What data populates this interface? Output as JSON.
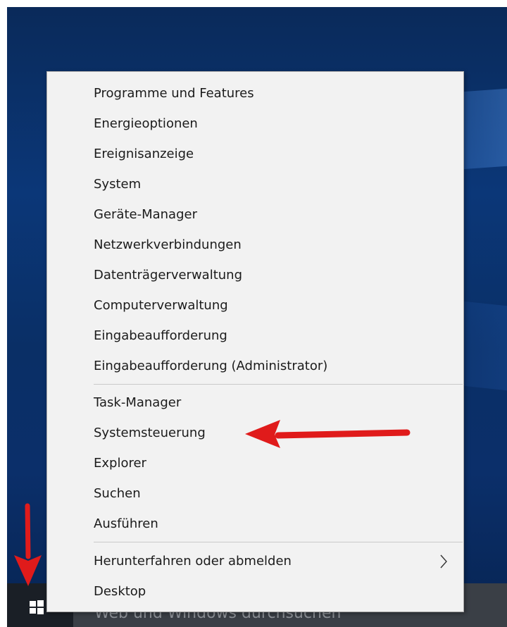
{
  "menu": {
    "group1": [
      {
        "label": "Programme und Features"
      },
      {
        "label": "Energieoptionen"
      },
      {
        "label": "Ereignisanzeige"
      },
      {
        "label": "System"
      },
      {
        "label": "Geräte-Manager"
      },
      {
        "label": "Netzwerkverbindungen"
      },
      {
        "label": "Datenträgerverwaltung"
      },
      {
        "label": "Computerverwaltung"
      },
      {
        "label": "Eingabeaufforderung"
      },
      {
        "label": "Eingabeaufforderung (Administrator)"
      }
    ],
    "group2": [
      {
        "label": "Task-Manager"
      },
      {
        "label": "Systemsteuerung"
      },
      {
        "label": "Explorer"
      },
      {
        "label": "Suchen"
      },
      {
        "label": "Ausführen"
      }
    ],
    "group3": [
      {
        "label": "Herunterfahren oder abmelden",
        "submenu_icon": "chevron-right-icon"
      },
      {
        "label": "Desktop"
      }
    ]
  },
  "taskbar": {
    "search_text": "Web und Windows durchsuchen",
    "start_icon": "windows-logo-icon"
  },
  "annotations": {
    "color": "#e01b1b",
    "arrow_to_item": "Systemsteuerung",
    "arrow_to_start": "windows-logo-icon"
  }
}
